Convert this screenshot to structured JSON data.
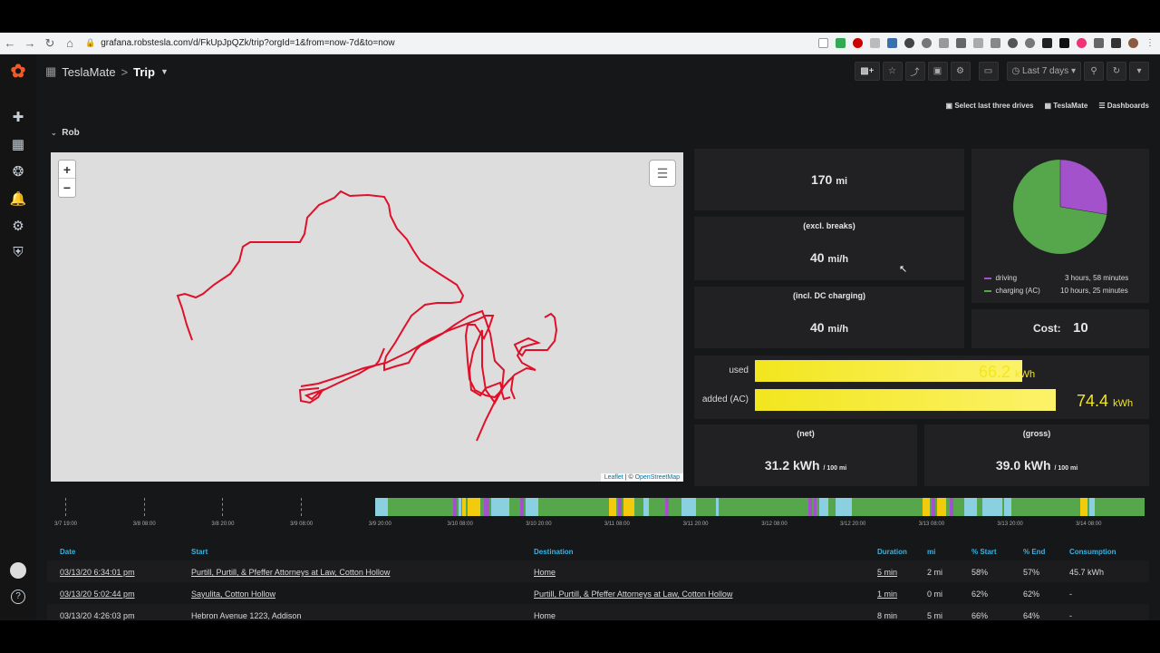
{
  "browser": {
    "url": "grafana.robstesla.com/d/FkUpJpQZk/trip?orgId=1&from=now-7d&to=now"
  },
  "header": {
    "breadcrumb_root": "TeslaMate",
    "separator": ">",
    "title": "Trip",
    "time_range": "Last 7 days"
  },
  "links": {
    "select_last": "Select last three drives",
    "teslamate": "TeslaMate",
    "dashboards": "Dashboards"
  },
  "row_title": "Rob",
  "map": {
    "zoom_in": "+",
    "zoom_out": "−",
    "attribution_leaflet": "Leaflet",
    "attribution_sep": " | © ",
    "attribution_osm": "OpenStreetMap"
  },
  "stats": {
    "distance_value": "170",
    "distance_unit": "mi",
    "speed1_label": "(excl. breaks)",
    "speed1_value": "40",
    "speed1_unit": "mi/h",
    "speed2_label": "(incl. DC charging)",
    "speed2_value": "40",
    "speed2_unit": "mi/h",
    "cost_label": "Cost:",
    "cost_value": "10"
  },
  "pie": {
    "colors": {
      "driving": "#a352cc",
      "charging": "#56a64b"
    },
    "fraction_driving": 0.276,
    "legend": [
      {
        "name": "driving",
        "value": "3 hours, 58 minutes"
      },
      {
        "name": "charging (AC)",
        "value": "10 hours, 25 minutes"
      }
    ]
  },
  "energy": {
    "used_label": "used",
    "used_value": "66.2",
    "used_unit": "kWh",
    "used_fraction": 0.89,
    "added_label": "added (AC)",
    "added_value": "74.4",
    "added_unit": "kWh",
    "added_fraction": 1.0,
    "net_label": "(net)",
    "net_value": "31.2 kWh",
    "net_unit": "/ 100 mi",
    "gross_label": "(gross)",
    "gross_value": "39.0 kWh",
    "gross_unit": "/ 100 mi"
  },
  "timeline": {
    "ticks": [
      "3/7 19:00",
      "3/8 08:00",
      "3/8 20:00",
      "3/9 08:00",
      "3/9 20:00",
      "3/10 08:00",
      "3/10 20:00",
      "3/11 08:00",
      "3/11 20:00",
      "3/12 08:00",
      "3/12 20:00",
      "3/13 08:00",
      "3/13 20:00",
      "3/14 08:00"
    ],
    "colors": {
      "charging": "#56a64b",
      "idle": "#8ad0e0",
      "driving": "#a352cc",
      "yellow": "#f2cc0c"
    }
  },
  "table": {
    "headers": [
      "Date",
      "Start",
      "Destination",
      "Duration",
      "mi",
      "% Start",
      "% End",
      "Consumption"
    ],
    "rows": [
      [
        "03/13/20 6:34:01 pm",
        "Purtill, Purtill, & Pfeffer Attorneys at Law, Cotton Hollow",
        "Home",
        "5 min",
        "2 mi",
        "58%",
        "57%",
        "45.7 kWh"
      ],
      [
        "03/13/20 5:02:44 pm",
        "Sayulita, Cotton Hollow",
        "Purtill, Purtill, & Pfeffer Attorneys at Law, Cotton Hollow",
        "1 min",
        "0 mi",
        "62%",
        "62%",
        "-"
      ],
      [
        "03/13/20 4:26:03 pm",
        "Hebron Avenue 1223, Addison",
        "Home",
        "8 min",
        "5 mi",
        "66%",
        "64%",
        "-"
      ]
    ]
  }
}
